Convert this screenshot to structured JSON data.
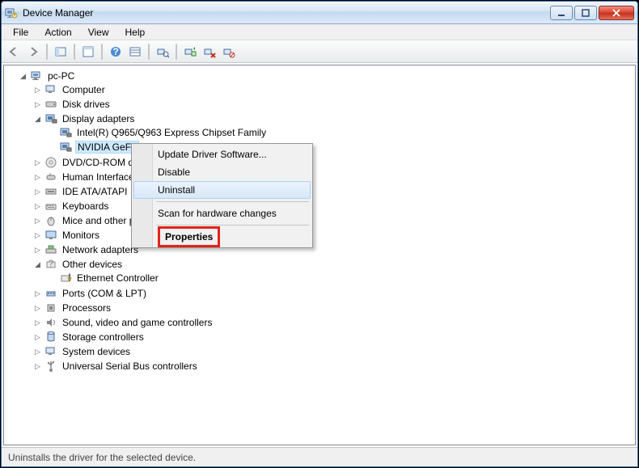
{
  "window": {
    "title": "Device Manager"
  },
  "menu": {
    "file": "File",
    "action": "Action",
    "view": "View",
    "help": "Help"
  },
  "tree": {
    "root": "pc-PC",
    "computer": "Computer",
    "disk": "Disk drives",
    "display": "Display adapters",
    "display_children": {
      "intel": "Intel(R)  Q965/Q963 Express Chipset Family",
      "nvidia": "NVIDIA GeFo"
    },
    "dvd": "DVD/CD-ROM d",
    "hid": "Human Interface",
    "ide": "IDE ATA/ATAPI",
    "keyboards": "Keyboards",
    "mice": "Mice and other p",
    "monitors": "Monitors",
    "netadapters": "Network adapters",
    "otherdev": "Other devices",
    "other_children": {
      "eth": "Ethernet Controller"
    },
    "ports": "Ports (COM & LPT)",
    "processors": "Processors",
    "sound": "Sound, video and game controllers",
    "storage": "Storage controllers",
    "system": "System devices",
    "usb": "Universal Serial Bus controllers"
  },
  "context": {
    "update": "Update Driver Software...",
    "disable": "Disable",
    "uninstall": "Uninstall",
    "scan": "Scan for hardware changes",
    "properties": "Properties"
  },
  "status": {
    "text": "Uninstalls the driver for the selected device."
  }
}
